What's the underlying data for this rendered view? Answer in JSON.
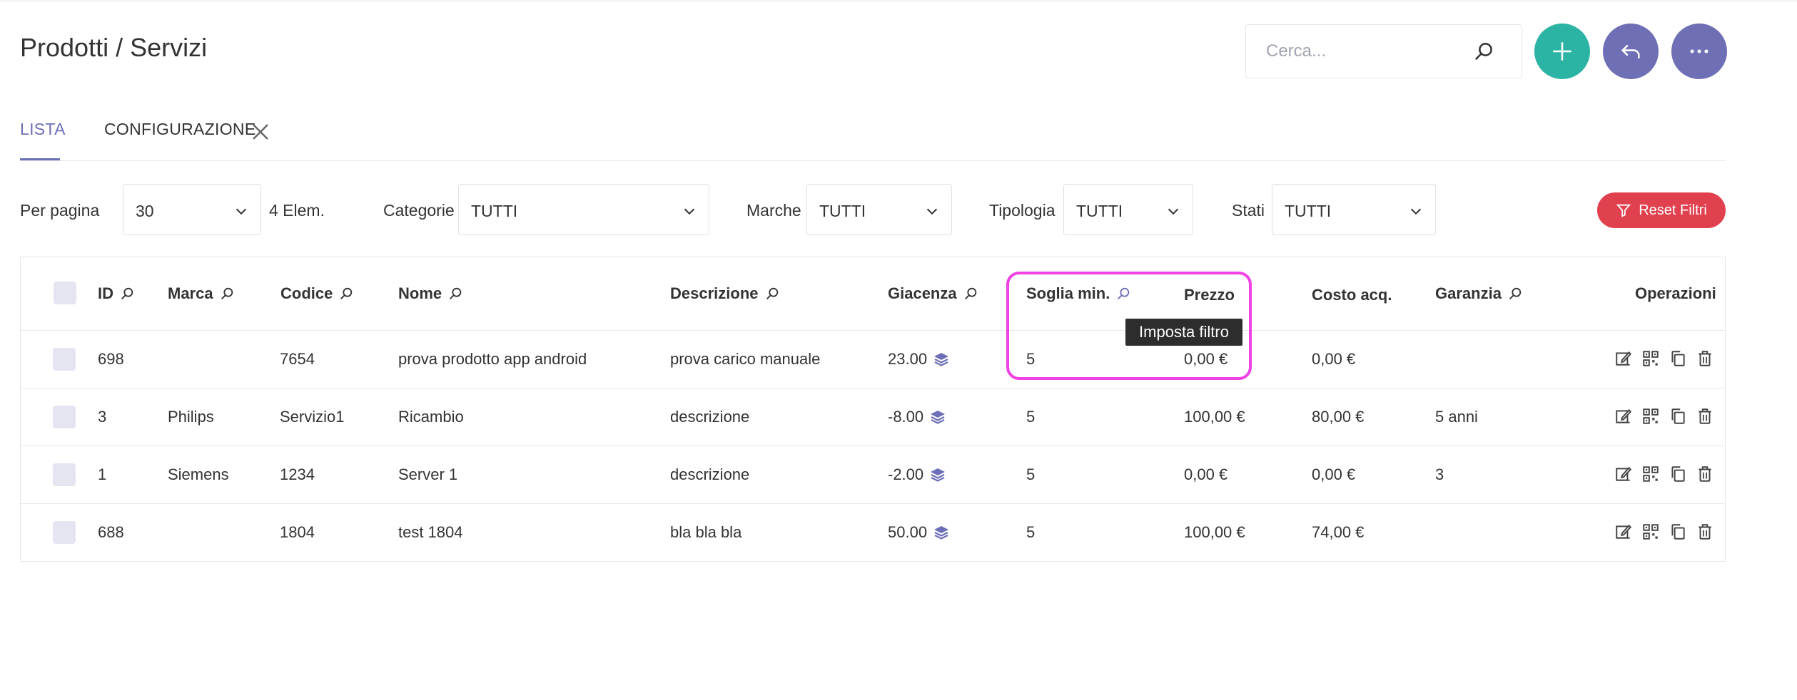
{
  "header": {
    "title": "Prodotti / Servizi",
    "search_placeholder": "Cerca..."
  },
  "tabs": {
    "lista": "LISTA",
    "configurazione": "CONFIGURAZIONE"
  },
  "filters": {
    "per_pagina_label": "Per pagina",
    "per_pagina_value": "30",
    "count": "4 Elem.",
    "categorie_label": "Categorie",
    "categorie_value": "TUTTI",
    "marche_label": "Marche",
    "marche_value": "TUTTI",
    "tipologia_label": "Tipologia",
    "tipologia_value": "TUTTI",
    "stati_label": "Stati",
    "stati_value": "TUTTI",
    "reset_label": "Reset Filtri"
  },
  "table": {
    "columns": {
      "id": "ID",
      "marca": "Marca",
      "codice": "Codice",
      "nome": "Nome",
      "descrizione": "Descrizione",
      "giacenza": "Giacenza",
      "soglia": "Soglia min.",
      "prezzo": "Prezzo",
      "costo": "Costo acq.",
      "garanzia": "Garanzia",
      "operazioni": "Operazioni"
    },
    "rows": [
      {
        "id": "698",
        "marca": "",
        "codice": "7654",
        "nome": "prova prodotto app android",
        "descrizione": "prova carico manuale",
        "giacenza": "23.00",
        "soglia": "5",
        "prezzo": "0,00 €",
        "costo": "0,00 €",
        "garanzia": ""
      },
      {
        "id": "3",
        "marca": "Philips",
        "codice": "Servizio1",
        "nome": "Ricambio",
        "descrizione": "descrizione",
        "giacenza": "-8.00",
        "soglia": "5",
        "prezzo": "100,00 €",
        "costo": "80,00 €",
        "garanzia": "5 anni"
      },
      {
        "id": "1",
        "marca": "Siemens",
        "codice": "1234",
        "nome": "Server 1",
        "descrizione": "descrizione",
        "giacenza": "-2.00",
        "soglia": "5",
        "prezzo": "0,00 €",
        "costo": "0,00 €",
        "garanzia": "3"
      },
      {
        "id": "688",
        "marca": "",
        "codice": "1804",
        "nome": "test 1804",
        "descrizione": "bla bla bla",
        "giacenza": "50.00",
        "soglia": "5",
        "prezzo": "100,00 €",
        "costo": "74,00 €",
        "garanzia": ""
      }
    ]
  },
  "tooltip": "Imposta filtro",
  "colors": {
    "accent": "#6d6fb8",
    "add_button": "#2bb3a3",
    "reset_button": "#e1404f",
    "highlight": "#f041e4"
  },
  "icons": {
    "search": "search-icon",
    "add": "plus-icon",
    "back": "undo-arrow-icon",
    "more": "ellipsis-icon",
    "close": "close-icon",
    "filter": "filter-icon",
    "stock": "layers-icon",
    "edit": "edit-icon",
    "qr": "qr-code-icon",
    "copy": "copy-icon",
    "delete": "trash-icon"
  }
}
